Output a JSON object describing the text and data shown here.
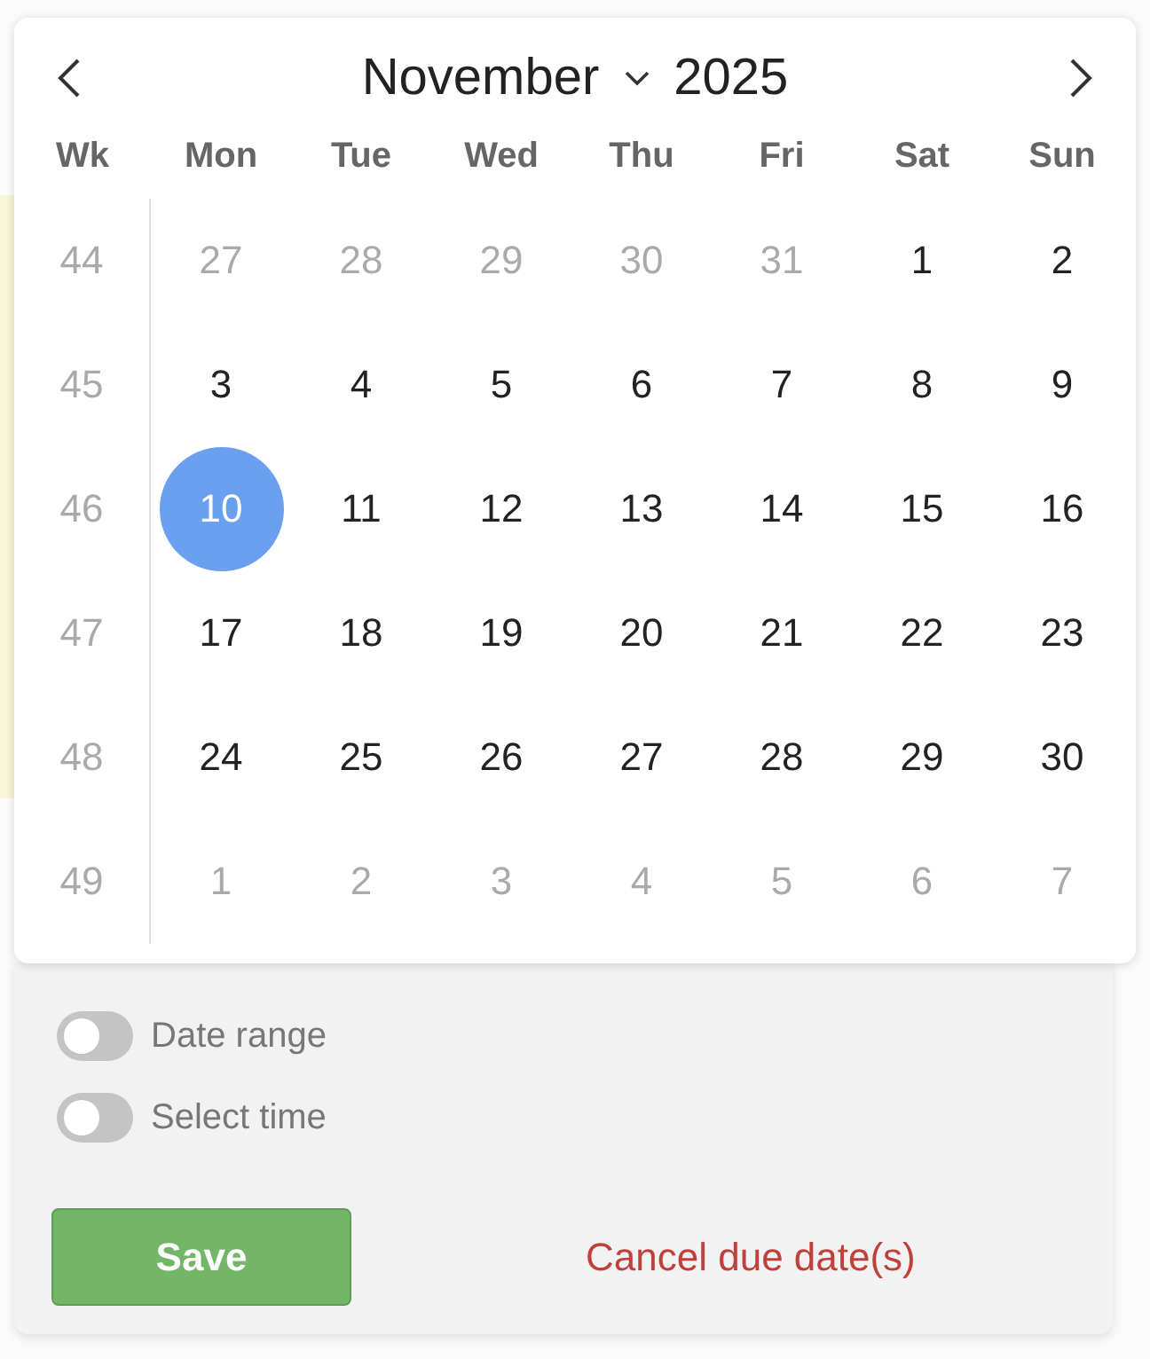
{
  "calendar": {
    "month": "November",
    "year": "2025",
    "headers": [
      "Wk",
      "Mon",
      "Tue",
      "Wed",
      "Thu",
      "Fri",
      "Sat",
      "Sun"
    ],
    "weeks": [
      {
        "number": "44",
        "days": [
          {
            "label": "27",
            "in_month": false,
            "selected": false
          },
          {
            "label": "28",
            "in_month": false,
            "selected": false
          },
          {
            "label": "29",
            "in_month": false,
            "selected": false
          },
          {
            "label": "30",
            "in_month": false,
            "selected": false
          },
          {
            "label": "31",
            "in_month": false,
            "selected": false
          },
          {
            "label": "1",
            "in_month": true,
            "selected": false
          },
          {
            "label": "2",
            "in_month": true,
            "selected": false
          }
        ]
      },
      {
        "number": "45",
        "days": [
          {
            "label": "3",
            "in_month": true,
            "selected": false
          },
          {
            "label": "4",
            "in_month": true,
            "selected": false
          },
          {
            "label": "5",
            "in_month": true,
            "selected": false
          },
          {
            "label": "6",
            "in_month": true,
            "selected": false
          },
          {
            "label": "7",
            "in_month": true,
            "selected": false
          },
          {
            "label": "8",
            "in_month": true,
            "selected": false
          },
          {
            "label": "9",
            "in_month": true,
            "selected": false
          }
        ]
      },
      {
        "number": "46",
        "days": [
          {
            "label": "10",
            "in_month": true,
            "selected": true
          },
          {
            "label": "11",
            "in_month": true,
            "selected": false
          },
          {
            "label": "12",
            "in_month": true,
            "selected": false
          },
          {
            "label": "13",
            "in_month": true,
            "selected": false
          },
          {
            "label": "14",
            "in_month": true,
            "selected": false
          },
          {
            "label": "15",
            "in_month": true,
            "selected": false
          },
          {
            "label": "16",
            "in_month": true,
            "selected": false
          }
        ]
      },
      {
        "number": "47",
        "days": [
          {
            "label": "17",
            "in_month": true,
            "selected": false
          },
          {
            "label": "18",
            "in_month": true,
            "selected": false
          },
          {
            "label": "19",
            "in_month": true,
            "selected": false
          },
          {
            "label": "20",
            "in_month": true,
            "selected": false
          },
          {
            "label": "21",
            "in_month": true,
            "selected": false
          },
          {
            "label": "22",
            "in_month": true,
            "selected": false
          },
          {
            "label": "23",
            "in_month": true,
            "selected": false
          }
        ]
      },
      {
        "number": "48",
        "days": [
          {
            "label": "24",
            "in_month": true,
            "selected": false
          },
          {
            "label": "25",
            "in_month": true,
            "selected": false
          },
          {
            "label": "26",
            "in_month": true,
            "selected": false
          },
          {
            "label": "27",
            "in_month": true,
            "selected": false
          },
          {
            "label": "28",
            "in_month": true,
            "selected": false
          },
          {
            "label": "29",
            "in_month": true,
            "selected": false
          },
          {
            "label": "30",
            "in_month": true,
            "selected": false
          }
        ]
      },
      {
        "number": "49",
        "days": [
          {
            "label": "1",
            "in_month": false,
            "selected": false
          },
          {
            "label": "2",
            "in_month": false,
            "selected": false
          },
          {
            "label": "3",
            "in_month": false,
            "selected": false
          },
          {
            "label": "4",
            "in_month": false,
            "selected": false
          },
          {
            "label": "5",
            "in_month": false,
            "selected": false
          },
          {
            "label": "6",
            "in_month": false,
            "selected": false
          },
          {
            "label": "7",
            "in_month": false,
            "selected": false
          }
        ]
      }
    ]
  },
  "options": [
    {
      "label": "Date range",
      "on": false
    },
    {
      "label": "Select time",
      "on": false
    }
  ],
  "save_button": "Save",
  "cancel_link": "Cancel due date(s)"
}
